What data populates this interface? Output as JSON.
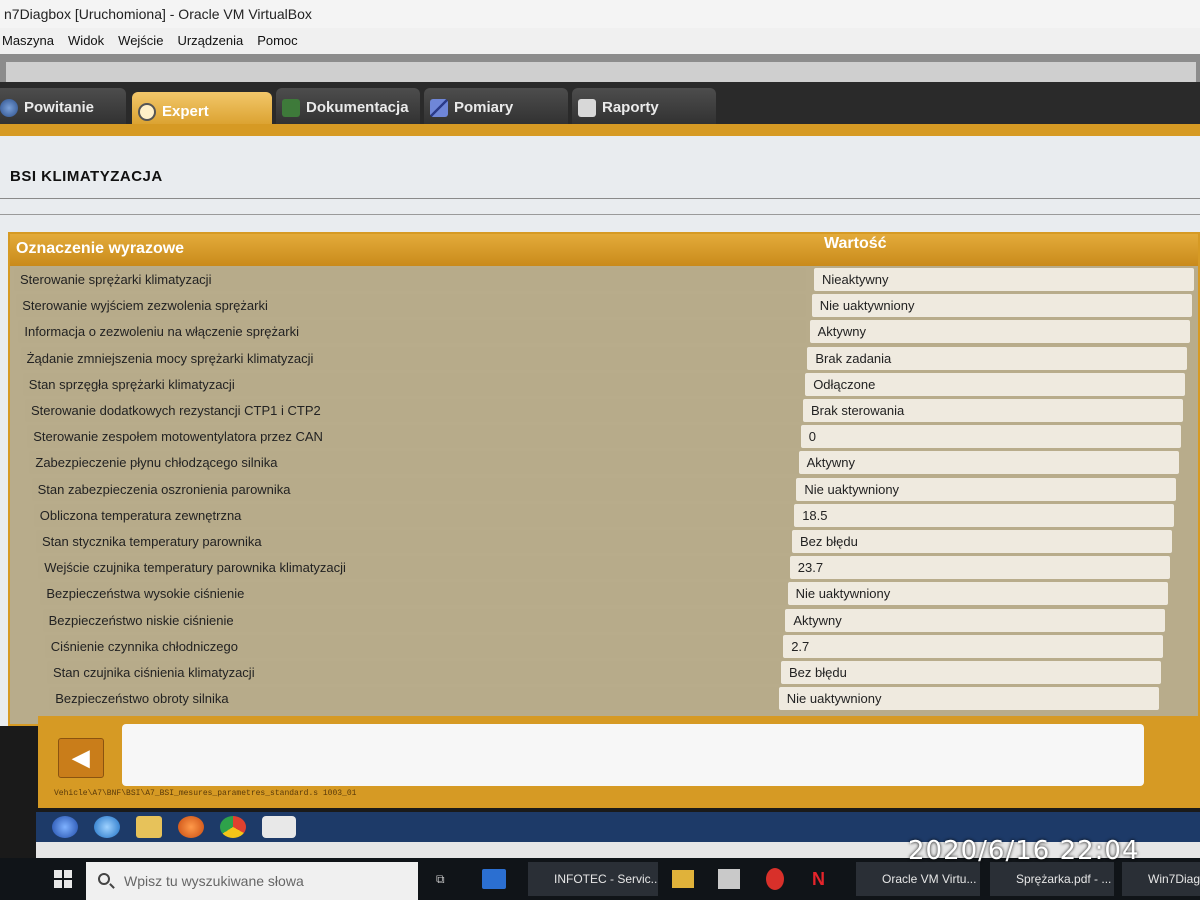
{
  "window": {
    "title": "n7Diagbox [Uruchomiona] - Oracle VM VirtualBox",
    "menu": [
      "Maszyna",
      "Widok",
      "Wejście",
      "Urządzenia",
      "Pomoc"
    ]
  },
  "tabs": [
    {
      "label": "Powitanie",
      "icon": "globe-icon",
      "active": false
    },
    {
      "label": "Expert",
      "icon": "magnifier-icon",
      "active": true
    },
    {
      "label": "Dokumentacja",
      "icon": "book-icon",
      "active": false
    },
    {
      "label": "Pomiary",
      "icon": "wave-icon",
      "active": false
    },
    {
      "label": "Raporty",
      "icon": "document-icon",
      "active": false
    }
  ],
  "page": {
    "title": "BSI  KLIMATYZACJA"
  },
  "table": {
    "header_label": "Oznaczenie wyrazowe",
    "header_value": "Wartość",
    "rows": [
      {
        "label": "Sterowanie sprężarki klimatyzacji",
        "value": "Nieaktywny"
      },
      {
        "label": "Sterowanie wyjściem zezwolenia sprężarki",
        "value": "Nie uaktywniony"
      },
      {
        "label": "Informacja o zezwoleniu na włączenie sprężarki",
        "value": "Aktywny"
      },
      {
        "label": "Żądanie zmniejszenia mocy sprężarki klimatyzacji",
        "value": "Brak zadania"
      },
      {
        "label": "Stan sprzęgła sprężarki klimatyzacji",
        "value": "Odłączone"
      },
      {
        "label": "Sterowanie dodatkowych rezystancji CTP1 i CTP2",
        "value": "Brak sterowania"
      },
      {
        "label": "Sterowanie zespołem motowentylatora przez CAN",
        "value": "0"
      },
      {
        "label": "Zabezpieczenie płynu chłodzącego silnika",
        "value": "Aktywny"
      },
      {
        "label": "Stan zabezpieczenia oszronienia parownika",
        "value": "Nie uaktywniony"
      },
      {
        "label": "Obliczona temperatura zewnętrzna",
        "value": "18.5"
      },
      {
        "label": "Stan stycznika temperatury parownika",
        "value": "Bez błędu"
      },
      {
        "label": "Wejście czujnika temperatury parownika klimatyzacji",
        "value": "23.7"
      },
      {
        "label": "Bezpieczeństwa wysokie ciśnienie",
        "value": "Nie uaktywniony"
      },
      {
        "label": "Bezpieczeństwo niskie ciśnienie",
        "value": "Aktywny"
      },
      {
        "label": "Ciśnienie czynnika chłodniczego",
        "value": "2.7"
      },
      {
        "label": "Stan czujnika ciśnienia klimatyzacji",
        "value": "Bez błędu"
      },
      {
        "label": "Bezpieczeństwo obroty silnika",
        "value": "Nie uaktywniony"
      }
    ]
  },
  "footer": {
    "path": "Vehicle\\A7\\BNF\\BSI\\A7_BSI_mesures_parametres_standard.s 1003_01"
  },
  "taskbar": {
    "search_placeholder": "Wpisz tu wyszukiwane słowa",
    "items": [
      "INFOTEC - Servic...",
      "Oracle VM Virtu...",
      "Sprężarka.pdf - ...",
      "Win7Diag..."
    ]
  },
  "photo_timestamp": "2020/6/16  22:04"
}
